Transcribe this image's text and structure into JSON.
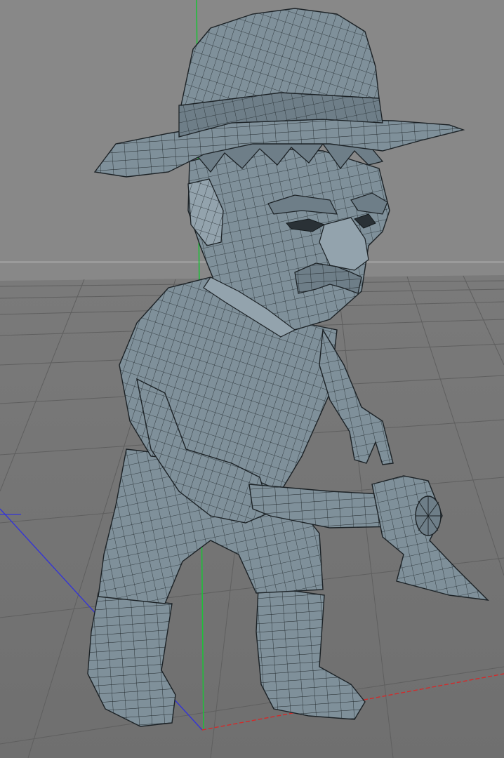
{
  "viewport": {
    "background_color": "#858585",
    "floor_color": "#7c7c7c",
    "grid_color": "#6a6a6a",
    "mesh_color": "#7f909a",
    "wire_color": "#20272b",
    "shading_mode": "wireframe-on-shaded"
  },
  "axes": {
    "x_axis_color": "#d22b2b",
    "y_axis_color": "#1fbf3a",
    "z_axis_color": "#3434d6"
  },
  "scene_objects": [
    {
      "name": "lumberjack-character",
      "part": "hat"
    },
    {
      "name": "lumberjack-character",
      "part": "head"
    },
    {
      "name": "lumberjack-character",
      "part": "torso"
    },
    {
      "name": "lumberjack-character",
      "part": "legs"
    },
    {
      "name": "lumberjack-character",
      "part": "boots"
    },
    {
      "name": "axe",
      "part": "handle"
    },
    {
      "name": "axe",
      "part": "blade"
    }
  ]
}
